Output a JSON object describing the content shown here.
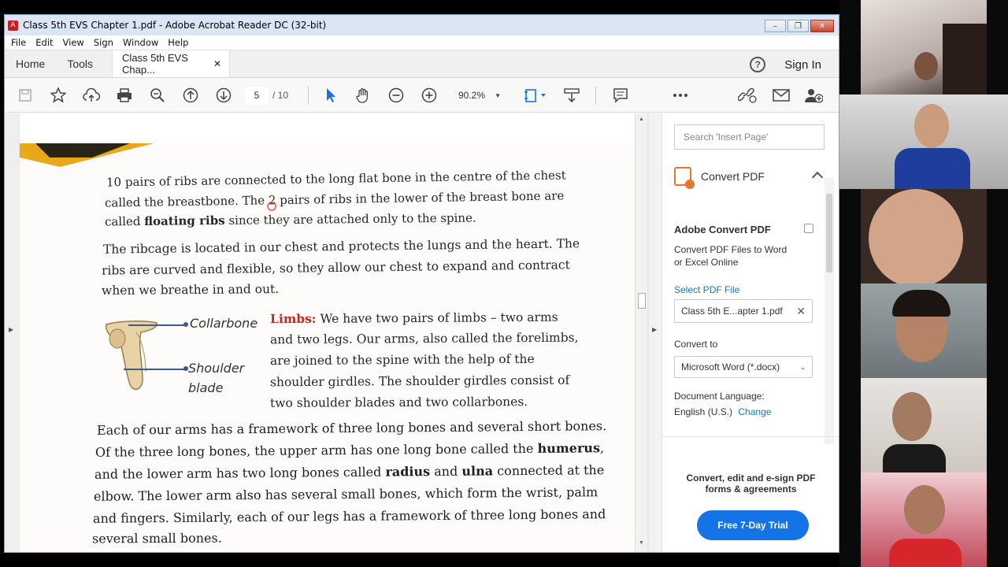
{
  "window": {
    "title": "Class 5th EVS Chapter 1.pdf - Adobe Acrobat Reader DC (32-bit)",
    "controls": [
      "–",
      "❐",
      "✕"
    ]
  },
  "menu": [
    "File",
    "Edit",
    "View",
    "Sign",
    "Window",
    "Help"
  ],
  "tabs": {
    "home": "Home",
    "tools": "Tools",
    "doc": "Class 5th EVS Chap...",
    "doc_close": "✕",
    "help": "?",
    "signin": "Sign In"
  },
  "toolbar": {
    "page_current": "5",
    "page_total": "/ 10",
    "zoom": "90.2%"
  },
  "document": {
    "ocr_lines": [
      "10 pairs of ribs are connected to the long flat bone in the centre of the chest",
      "called the breastbone. The 2 pairs of ribs in the lower of the breast bone are",
      "since they are attached only to the spine."
    ],
    "floating_prefix": "called ",
    "floating_bold": "floating ribs",
    "para2": [
      "The ribcage is located in our chest and protects the lungs and the heart. The",
      "ribs are curved and flexible, so they allow our chest to expand and contract",
      "when we breathe in and out."
    ],
    "limbs_label": "Limbs:",
    "limbs_lines": [
      " We have two pairs of limbs – two arms",
      "and two legs. Our arms, also called the forelimbs,",
      "are joined to the spine with the help of the",
      "shoulder girdles. The shoulder girdles consist of",
      "two shoulder blades and two collarbones."
    ],
    "diagram_labels": {
      "collarbone": "Collarbone",
      "shoulder": "Shoulder",
      "blade": "blade"
    },
    "para3": {
      "l1": "Each of our arms has a framework of three long bones and several short bones.",
      "l2a": "Of the three long bones, the upper arm has one long bone called the ",
      "l2b": "humerus",
      "l2c": ",",
      "l3a": "and the lower arm has two long bones called ",
      "l3b": "radius",
      "l3c": " and ",
      "l3d": "ulna",
      "l3e": " connected at the",
      "l4": "elbow. The lower arm also has several small bones, which form the wrist, palm",
      "l5": "and fingers. Similarly, each of our legs has a framework of three long bones and",
      "l6": "several small bones."
    }
  },
  "right_panel": {
    "search_placeholder": "Search 'Insert Page'",
    "convert_header": "Convert PDF",
    "title": "Adobe Convert PDF",
    "desc1": "Convert PDF Files to Word",
    "desc2": "or Excel Online",
    "select_file": "Select PDF File",
    "file_name": "Class 5th E...apter 1.pdf",
    "convert_to": "Convert to",
    "format": "Microsoft Word (*.docx)",
    "lang_label": "Document Language:",
    "lang_value": "English (U.S.)",
    "lang_change": "Change",
    "promo1": "Convert, edit and e-sign PDF",
    "promo2": "forms & agreements",
    "trial": "Free 7-Day Trial"
  },
  "colors": {
    "accent": "#1473e6",
    "limbs_red": "#c8281a",
    "banner": "#e9a71a"
  }
}
